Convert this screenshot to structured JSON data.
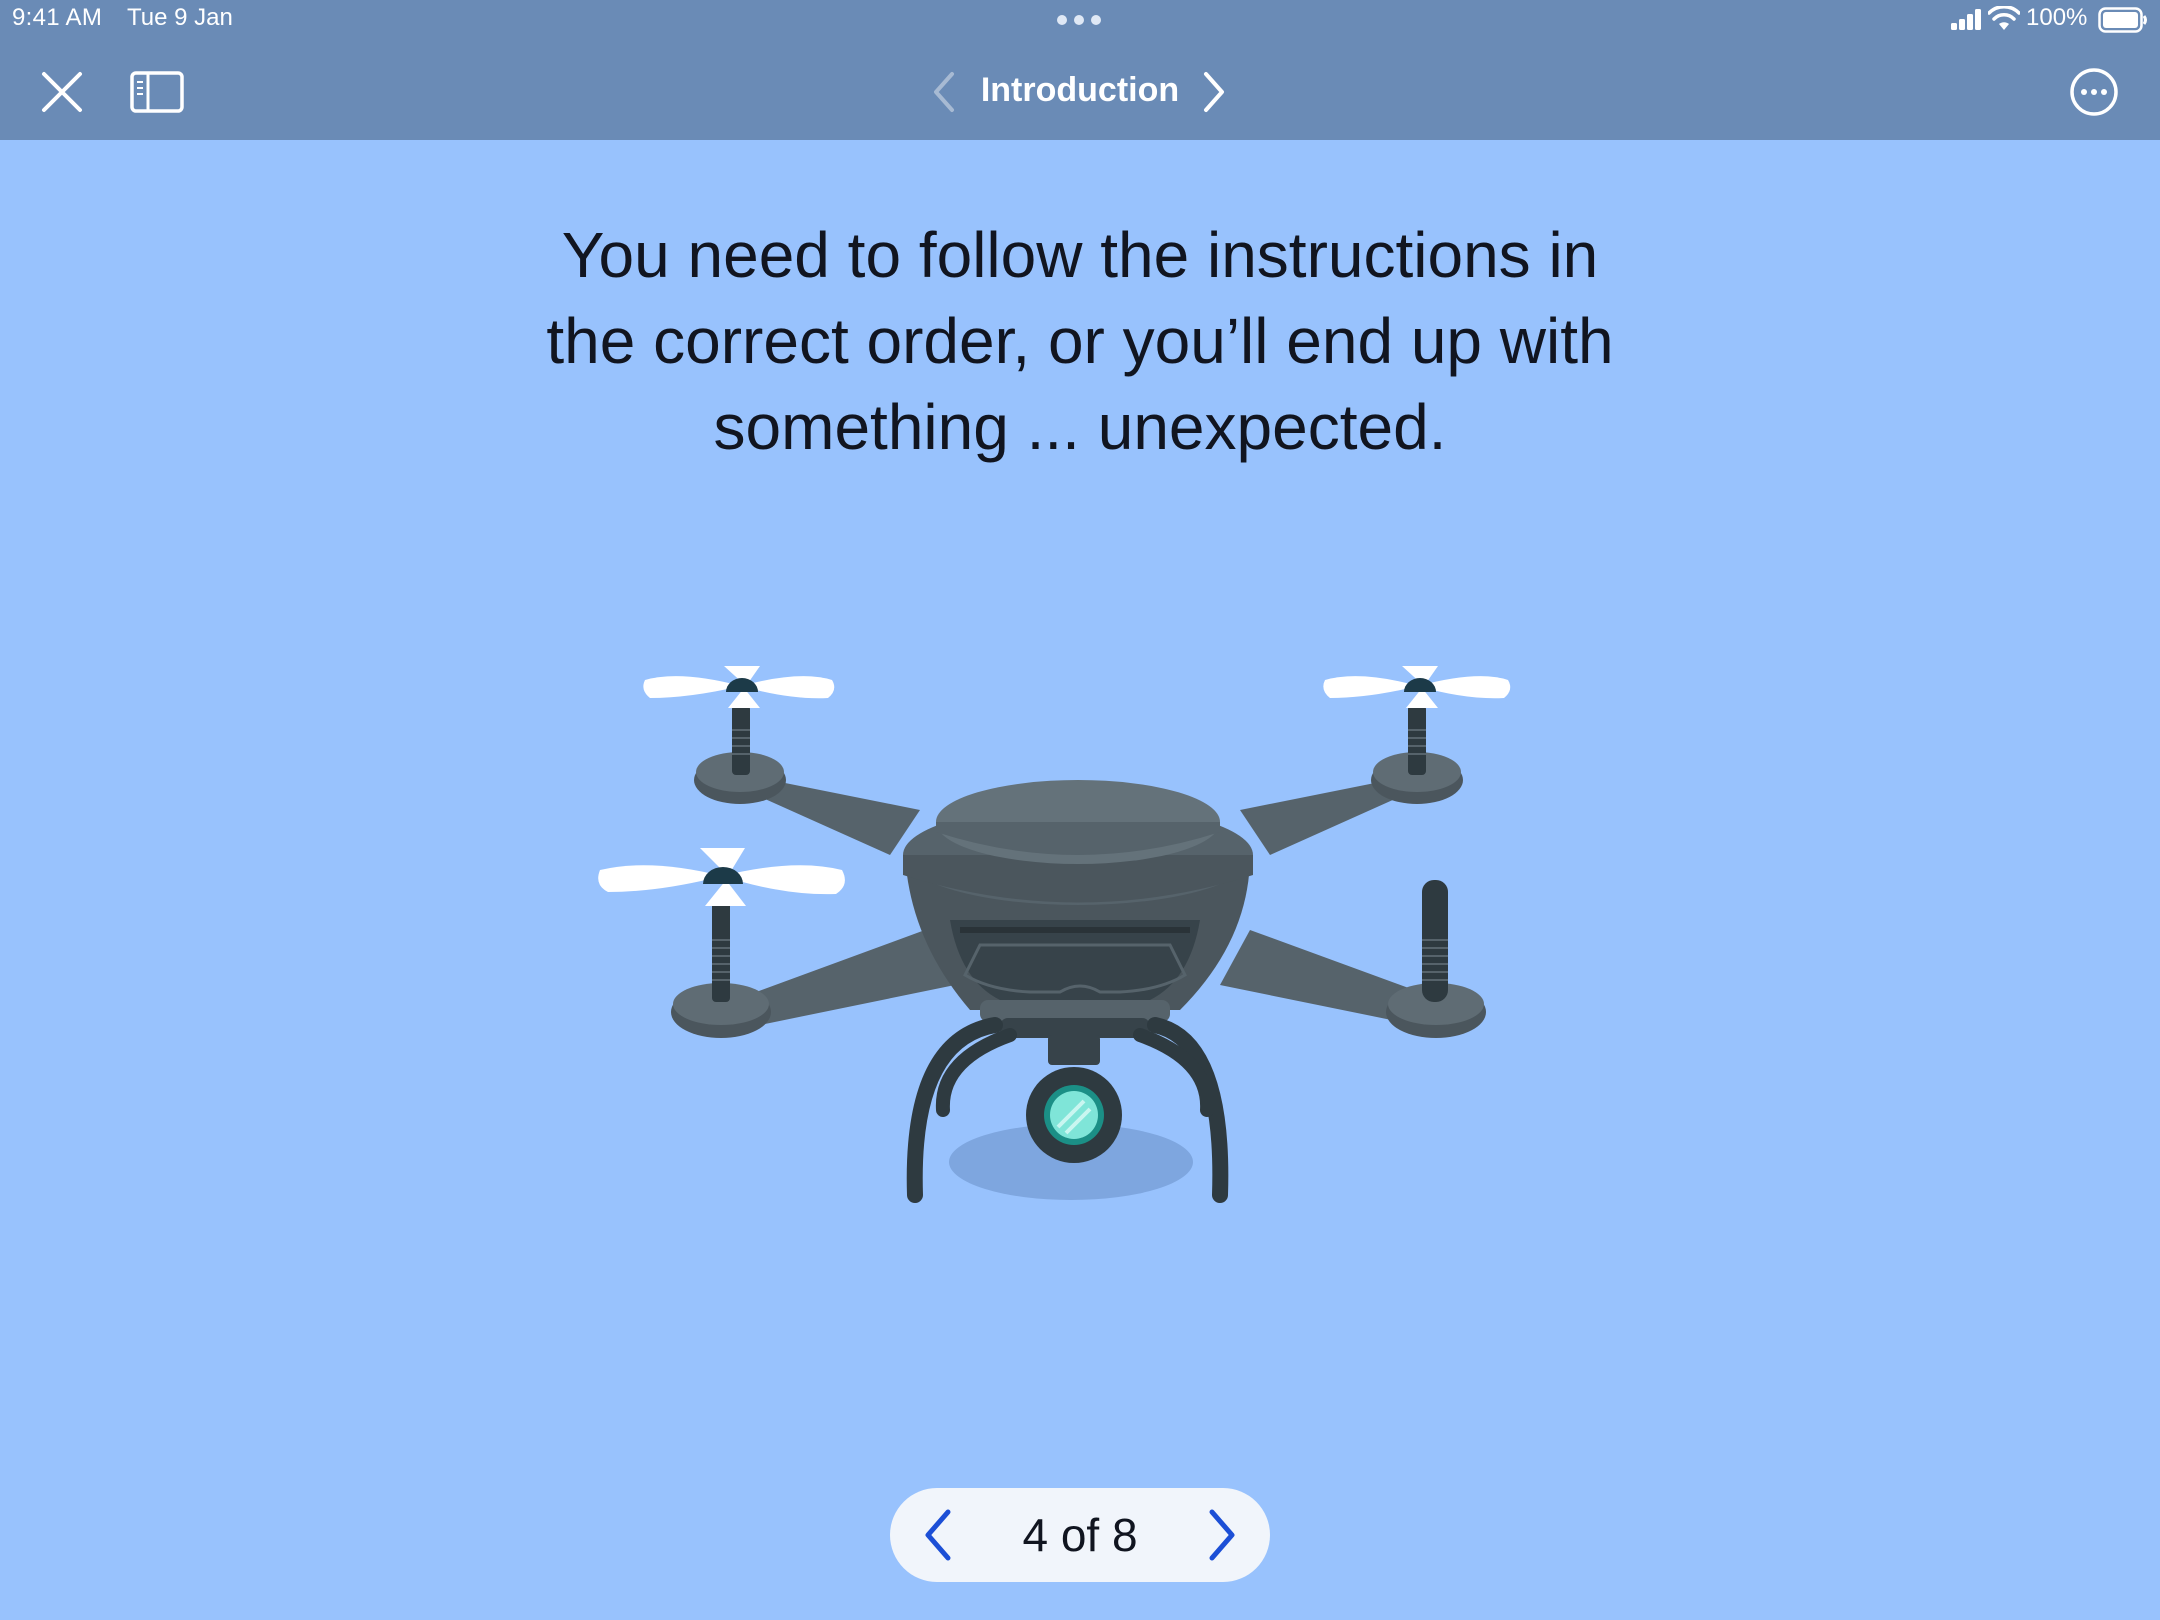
{
  "status_bar": {
    "time": "9:41 AM",
    "date": "Tue 9 Jan",
    "battery": "100%"
  },
  "toolbar": {
    "title": "Introduction"
  },
  "content": {
    "line1": "You need to follow the instructions in",
    "line2": "the correct order, or you’ll end up with",
    "line3": "something ... unexpected.",
    "illustration_icon": "drone-icon"
  },
  "pager": {
    "label": "4 of 8"
  },
  "colors": {
    "background": "#98c2fd",
    "toolbar": "#6a8bb6",
    "accent": "#1c4fd6"
  }
}
